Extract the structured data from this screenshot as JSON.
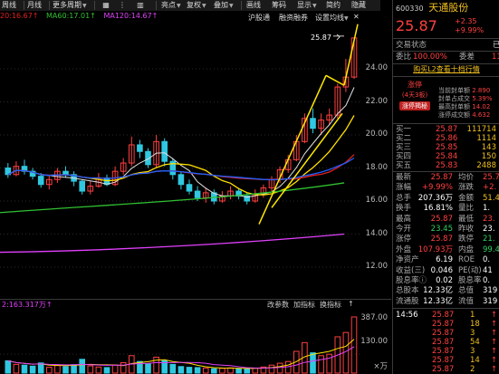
{
  "toolbar": {
    "items": [
      "周线",
      "月线",
      "更多周期",
      "",
      "",
      "亮点",
      "复权",
      "叠加",
      "画线",
      "筹码",
      "显示",
      "简约",
      "隐藏"
    ],
    "second_row": [
      "沪股通",
      "融资融券",
      "设置均线"
    ]
  },
  "ma_legend": {
    "ma20": "20:16.67↑",
    "ma60": "MA60:17.01↑",
    "ma120": "MA120:14.67↑"
  },
  "price_axis": [
    "24.00",
    "22.00",
    "20.00",
    "18.00",
    "16.00",
    "14.00",
    "12.00"
  ],
  "peak_label": "25.87",
  "volume": {
    "legend": "2:163.317万↑",
    "buttons": [
      "改参数",
      "加指标",
      "换指标"
    ],
    "axis": [
      "387.00",
      "130.00",
      "×万"
    ]
  },
  "panel": {
    "code": "600330",
    "name": "天通股份",
    "price": "25.87",
    "change": "+2.35",
    "change_pct": "+9.99%",
    "state_label": "交易状态",
    "state_value": "已",
    "weibi_label": "委比",
    "weibi_value": "100.00%",
    "weicha_label": "委差",
    "weicha_value": "11",
    "l2_button": "购买L2查看十档行情",
    "limit_tag": "涨停",
    "limit_days": "(4天3板)",
    "limit_btn": "涨停揭秘",
    "limit_info": [
      {
        "label": "当前封单额",
        "value": "2.890"
      },
      {
        "label": "封单占成交",
        "value": "5.39%"
      },
      {
        "label": "最高封单额",
        "value": "14.02"
      },
      {
        "label": "涨停成交额",
        "value": "4.632"
      }
    ],
    "bids": [
      {
        "label": "买一",
        "price": "25.87",
        "vol": "111714"
      },
      {
        "label": "买二",
        "price": "25.86",
        "vol": "1114"
      },
      {
        "label": "买三",
        "price": "25.85",
        "vol": "143"
      },
      {
        "label": "买四",
        "price": "25.84",
        "vol": "150"
      },
      {
        "label": "买五",
        "price": "25.83",
        "vol": "2488"
      }
    ],
    "stats": [
      {
        "l1": "最新",
        "v1": "25.87",
        "l2": "均价",
        "v2": "25.7",
        "c1": "red",
        "c2": "red"
      },
      {
        "l1": "涨幅",
        "v1": "+9.99%",
        "l2": "涨跌",
        "v2": "+2.",
        "c1": "red",
        "c2": "red"
      },
      {
        "l1": "总手",
        "v1": "207.36万",
        "l2": "金额",
        "v2": "51.4",
        "c1": "white",
        "c2": "yellow"
      },
      {
        "l1": "换手",
        "v1": "16.81%",
        "l2": "量比",
        "v2": "1.",
        "c1": "white",
        "c2": "white"
      },
      {
        "l1": "最高",
        "v1": "25.87",
        "l2": "最低",
        "v2": "23.",
        "c1": "red",
        "c2": "red"
      },
      {
        "l1": "今开",
        "v1": "23.45",
        "l2": "昨收",
        "v2": "23.",
        "c1": "green",
        "c2": "white"
      },
      {
        "l1": "涨停",
        "v1": "25.87",
        "l2": "跌停",
        "v2": "21.",
        "c1": "red",
        "c2": "green"
      },
      {
        "l1": "外盘",
        "v1": "107.93万",
        "l2": "内盘",
        "v2": "99.4",
        "c1": "red",
        "c2": "green"
      },
      {
        "l1": "净资产",
        "v1": "6.19",
        "l2": "ROE",
        "v2": "0.",
        "c1": "white",
        "c2": "white"
      },
      {
        "l1": "收益(三)",
        "v1": "0.046",
        "l2": "PE(动)",
        "v2": "41",
        "c1": "white",
        "c2": "white"
      },
      {
        "l1": "股息率ⓘ",
        "v1": "0.02",
        "l2": "股息率",
        "v2": "0.",
        "c1": "white",
        "c2": "white"
      },
      {
        "l1": "总股本",
        "v1": "12.33亿",
        "l2": "总值",
        "v2": "319",
        "c1": "white",
        "c2": "white"
      },
      {
        "l1": "流通股",
        "v1": "12.33亿",
        "l2": "流值",
        "v2": "319",
        "c1": "white",
        "c2": "white"
      }
    ],
    "trades": [
      {
        "time": "14:56",
        "price": "25.87",
        "vol": "1",
        "dir": ""
      },
      {
        "time": "",
        "price": "25.87",
        "vol": "18",
        "dir": ""
      },
      {
        "time": "",
        "price": "25.87",
        "vol": "3",
        "dir": ""
      },
      {
        "time": "",
        "price": "25.87",
        "vol": "54",
        "dir": ""
      },
      {
        "time": "",
        "price": "25.87",
        "vol": "3",
        "dir": ""
      },
      {
        "time": "",
        "price": "25.87",
        "vol": "14",
        "dir": ""
      },
      {
        "time": "",
        "price": "25.87",
        "vol": "2",
        "dir": ""
      }
    ]
  },
  "colors": {
    "up": "#ff4040",
    "down": "#30c8e0",
    "ma5": "#e0e0e0",
    "ma10": "#ffe000",
    "ma20": "#e02020",
    "ma30": "#2060ff",
    "ma60": "#30c030",
    "ma120": "#e040fb"
  }
}
